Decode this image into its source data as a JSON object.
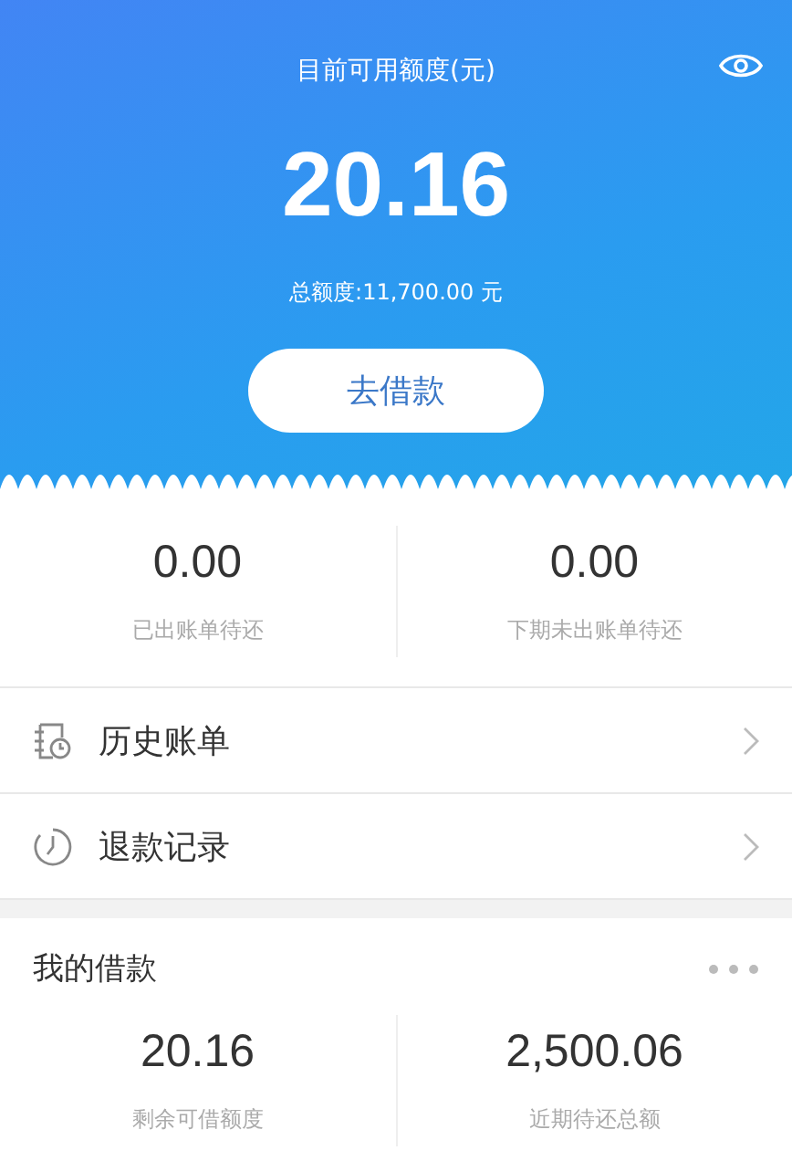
{
  "header": {
    "title": "目前可用额度(元)",
    "amount": "20.16",
    "total": "总额度:11,700.00 元",
    "button": "去借款"
  },
  "stats": [
    {
      "value": "0.00",
      "label": "已出账单待还"
    },
    {
      "value": "0.00",
      "label": "下期未出账单待还"
    }
  ],
  "menu": [
    {
      "kind": "history",
      "label": "历史账单"
    },
    {
      "kind": "refund",
      "label": "退款记录"
    }
  ],
  "loans": {
    "title": "我的借款",
    "stats": [
      {
        "value": "20.16",
        "label": "剩余可借额度"
      },
      {
        "value": "2,500.06",
        "label": "近期待还总额"
      }
    ]
  }
}
